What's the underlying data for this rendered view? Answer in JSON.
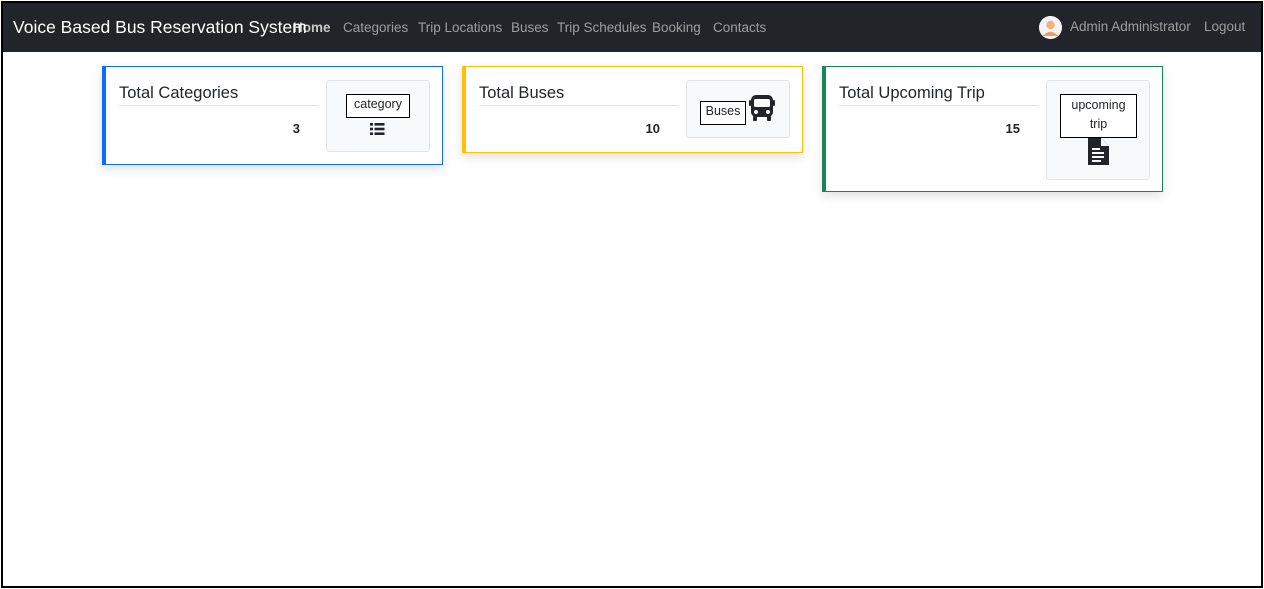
{
  "navbar": {
    "brand": "Voice Based Bus Reservation System",
    "items": [
      {
        "label": "Home",
        "active": true
      },
      {
        "label": "Categories"
      },
      {
        "label": "Trip Locations"
      },
      {
        "label": "Buses"
      },
      {
        "label": "Trip Schedules"
      },
      {
        "label": "Booking"
      },
      {
        "label": "Contacts"
      }
    ],
    "user": "Admin Administrator",
    "logout": "Logout"
  },
  "cards": [
    {
      "title": "Total Categories",
      "count": "3",
      "icon_label": "category",
      "icon": "list-icon",
      "accent": "#0d6efd"
    },
    {
      "title": "Total Buses",
      "count": "10",
      "icon_label": "Buses",
      "icon": "bus-icon",
      "accent": "#ffc107"
    },
    {
      "title": "Total Upcoming Trip",
      "count": "15",
      "icon_label": "upcoming trip",
      "icon": "file-icon",
      "accent": "#198754"
    }
  ]
}
